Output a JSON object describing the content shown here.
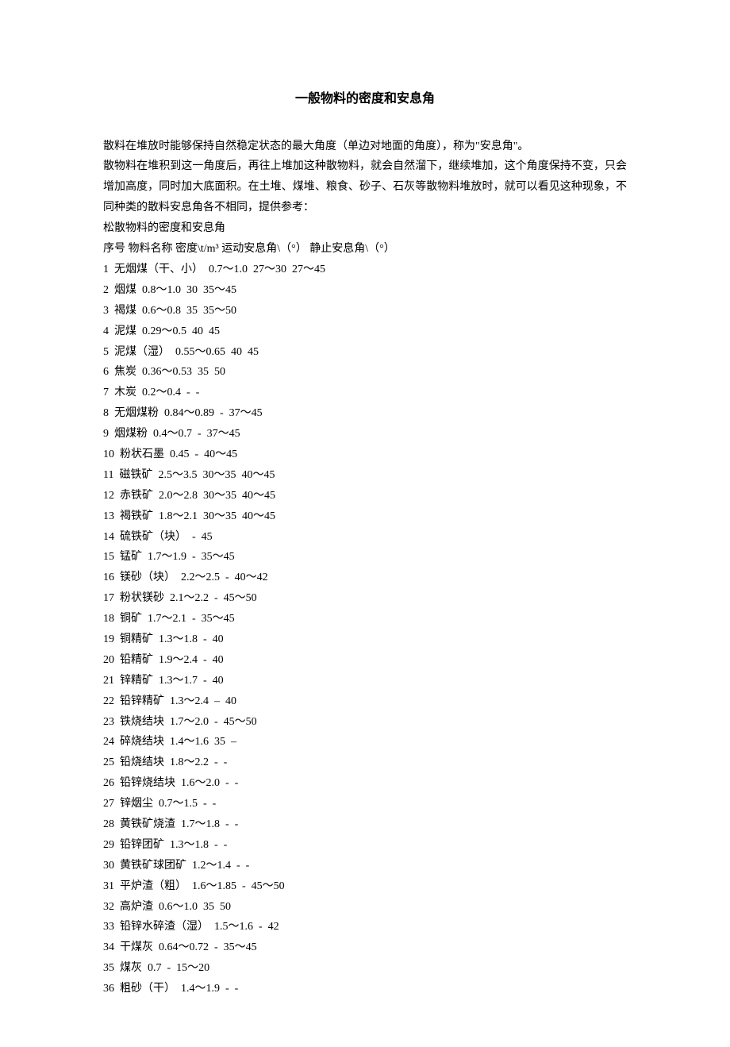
{
  "title": "一般物料的密度和安息角",
  "intro": {
    "p1": "散料在堆放时能够保持自然稳定状态的最大角度（单边对地面的角度），称为\"安息角\"。",
    "p2": "散物料在堆积到这一角度后，再往上堆加这种散物料，就会自然溜下，继续堆加，这个角度保持不变，只会增加高度，同时加大底面积。在土堆、煤堆、粮食、砂子、石灰等散物料堆放时，就可以看见这种现象，不同种类的散料安息角各不相同，提供参考：",
    "section_label": "松散物料的密度和安息角"
  },
  "columns": {
    "c1": "序号",
    "c2": "物料名称",
    "c3": "密度\\t/m³",
    "c4": "运动安息角\\（°）",
    "c5": "静止安息角\\（°）"
  },
  "rows": [
    {
      "i": "1",
      "n": "无烟煤（干、小）",
      "d": "0.7～1.0",
      "m": "27～30",
      "s": "27～45"
    },
    {
      "i": "2",
      "n": "烟煤",
      "d": "0.8～1.0",
      "m": "30",
      "s": "35～45"
    },
    {
      "i": "3",
      "n": "褐煤",
      "d": "0.6～0.8",
      "m": "35",
      "s": "35～50"
    },
    {
      "i": "4",
      "n": "泥煤",
      "d": "0.29～0.5",
      "m": "40",
      "s": "45"
    },
    {
      "i": "5",
      "n": "泥煤（湿）",
      "d": "0.55～0.65",
      "m": "40",
      "s": "45"
    },
    {
      "i": "6",
      "n": "焦炭",
      "d": "0.36～0.53",
      "m": "35",
      "s": "50"
    },
    {
      "i": "7",
      "n": "木炭",
      "d": "0.2～0.4",
      "m": "-",
      "s": "-"
    },
    {
      "i": "8",
      "n": "无烟煤粉",
      "d": "0.84～0.89",
      "m": "-",
      "s": "37～45"
    },
    {
      "i": "9",
      "n": "烟煤粉",
      "d": "0.4～0.7",
      "m": "-",
      "s": "37～45"
    },
    {
      "i": "10",
      "n": "粉状石墨",
      "d": "0.45",
      "m": "-",
      "s": "40～45"
    },
    {
      "i": "11",
      "n": "磁铁矿",
      "d": "2.5～3.5",
      "m": "30～35",
      "s": "40～45"
    },
    {
      "i": "12",
      "n": "赤铁矿",
      "d": "2.0～2.8",
      "m": "30～35",
      "s": "40～45"
    },
    {
      "i": "13",
      "n": "褐铁矿",
      "d": "1.8～2.1",
      "m": "30～35",
      "s": "40～45"
    },
    {
      "i": "14",
      "n": "硫铁矿（块）",
      "d": "",
      "m": "-",
      "s": "45"
    },
    {
      "i": "15",
      "n": "锰矿",
      "d": "1.7～1.9",
      "m": "-",
      "s": "35～45"
    },
    {
      "i": "16",
      "n": "镁砂（块）",
      "d": "2.2～2.5",
      "m": "-",
      "s": "40～42"
    },
    {
      "i": "17",
      "n": "粉状镁砂",
      "d": "2.1～2.2",
      "m": "-",
      "s": "45～50"
    },
    {
      "i": "18",
      "n": "铜矿",
      "d": "1.7～2.1",
      "m": "-",
      "s": "35～45"
    },
    {
      "i": "19",
      "n": "铜精矿",
      "d": "1.3～1.8",
      "m": "-",
      "s": "40"
    },
    {
      "i": "20",
      "n": "铅精矿",
      "d": "1.9～2.4",
      "m": "-",
      "s": "40"
    },
    {
      "i": "21",
      "n": "锌精矿",
      "d": "1.3～1.7",
      "m": "-",
      "s": "40"
    },
    {
      "i": "22",
      "n": "铅锌精矿",
      "d": "1.3～2.4",
      "m": "–",
      "s": "40"
    },
    {
      "i": "23",
      "n": "铁烧结块",
      "d": "1.7～2.0",
      "m": "-",
      "s": "45～50"
    },
    {
      "i": "24",
      "n": "碎烧结块",
      "d": "1.4～1.6",
      "m": "35",
      "s": "–"
    },
    {
      "i": "25",
      "n": "铅烧结块",
      "d": "1.8～2.2",
      "m": "-",
      "s": "-"
    },
    {
      "i": "26",
      "n": "铅锌烧结块",
      "d": "1.6～2.0",
      "m": "-",
      "s": "-"
    },
    {
      "i": "27",
      "n": "锌烟尘",
      "d": "0.7～1.5",
      "m": "-",
      "s": "-"
    },
    {
      "i": "28",
      "n": "黄铁矿烧渣",
      "d": "1.7～1.8",
      "m": "-",
      "s": "-"
    },
    {
      "i": "29",
      "n": "铅锌团矿",
      "d": "1.3～1.8",
      "m": "-",
      "s": "-"
    },
    {
      "i": "30",
      "n": "黄铁矿球团矿",
      "d": "1.2～1.4",
      "m": "-",
      "s": "-"
    },
    {
      "i": "31",
      "n": "平炉渣（粗）",
      "d": "1.6～1.85",
      "m": "-",
      "s": "45～50"
    },
    {
      "i": "32",
      "n": "高炉渣",
      "d": "0.6～1.0",
      "m": "35",
      "s": "50"
    },
    {
      "i": "33",
      "n": "铅锌水碎渣（湿）",
      "d": "1.5～1.6",
      "m": "-",
      "s": "42"
    },
    {
      "i": "34",
      "n": "干煤灰",
      "d": "0.64～0.72",
      "m": "-",
      "s": "35～45"
    },
    {
      "i": "35",
      "n": "煤灰",
      "d": "0.7",
      "m": "-",
      "s": "15～20"
    },
    {
      "i": "36",
      "n": "粗砂（干）",
      "d": "1.4～1.9",
      "m": "-",
      "s": "-"
    }
  ]
}
